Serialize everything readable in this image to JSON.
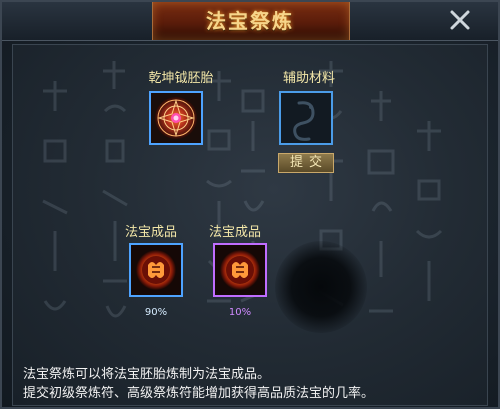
{
  "window": {
    "title": "法宝祭炼"
  },
  "slots": {
    "embryo_label": "乾坤钺胚胎",
    "aux_label": "辅助材料",
    "submit_label": "提交"
  },
  "products": [
    {
      "label": "法宝成品",
      "rate": "90%",
      "quality_color": "#4ea3ff"
    },
    {
      "label": "法宝成品",
      "rate": "10%",
      "quality_color": "#c06dff"
    }
  ],
  "description": {
    "line1": "法宝祭炼可以将法宝胚胎炼制为法宝成品。",
    "line2": "提交初级祭炼符、高级祭炼符能增加获得高品质法宝的几率。"
  },
  "icons": {
    "close": "close-icon",
    "embryo": "magic-circle-icon",
    "aux": "scroll-dragon-icon",
    "product": "flame-medallion-icon"
  }
}
